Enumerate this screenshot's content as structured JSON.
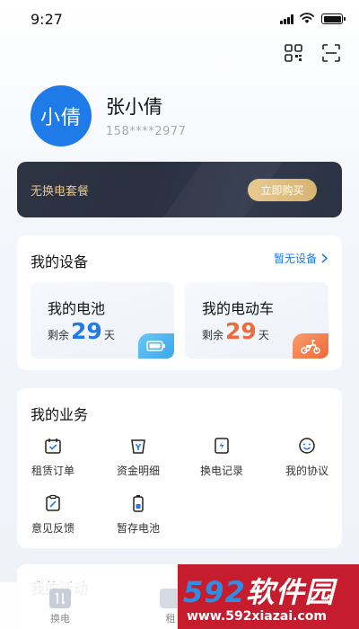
{
  "status_bar": {
    "time": "9:27"
  },
  "header": {
    "icons": [
      "qr-code-icon",
      "scan-icon"
    ]
  },
  "profile": {
    "avatar_text": "小倩",
    "name": "张小倩",
    "phone": "158****2977"
  },
  "package": {
    "text": "无换电套餐",
    "buy_label": "立即购买"
  },
  "devices": {
    "title": "我的设备",
    "link_label": "暂无设备",
    "battery": {
      "name": "我的电池",
      "remain_prefix": "剩余",
      "days": "29",
      "unit": "天",
      "icon": "battery-icon"
    },
    "scooter": {
      "name": "我的电动车",
      "remain_prefix": "剩余",
      "days": "29",
      "unit": "天",
      "icon": "scooter-icon"
    }
  },
  "business": {
    "title": "我的业务",
    "items": [
      {
        "label": "租赁订单",
        "icon": "lease-order-icon"
      },
      {
        "label": "资金明细",
        "icon": "funds-detail-icon"
      },
      {
        "label": "换电记录",
        "icon": "swap-record-icon"
      },
      {
        "label": "我的协议",
        "icon": "agreement-icon"
      },
      {
        "label": "意见反馈",
        "icon": "feedback-icon"
      },
      {
        "label": "暂存电池",
        "icon": "stored-battery-icon"
      }
    ]
  },
  "activity": {
    "title": "我的活动"
  },
  "tabbar": {
    "tabs": [
      {
        "label": "换电"
      },
      {
        "label": "租"
      }
    ]
  },
  "watermark": {
    "digits": "592",
    "brand": "软件园",
    "url": "www.592xiazai.com"
  },
  "colors": {
    "accent": "#1e7be8",
    "orange": "#ef6b3a",
    "gold": "#e8c58a",
    "dark_card": "#2d3444"
  }
}
